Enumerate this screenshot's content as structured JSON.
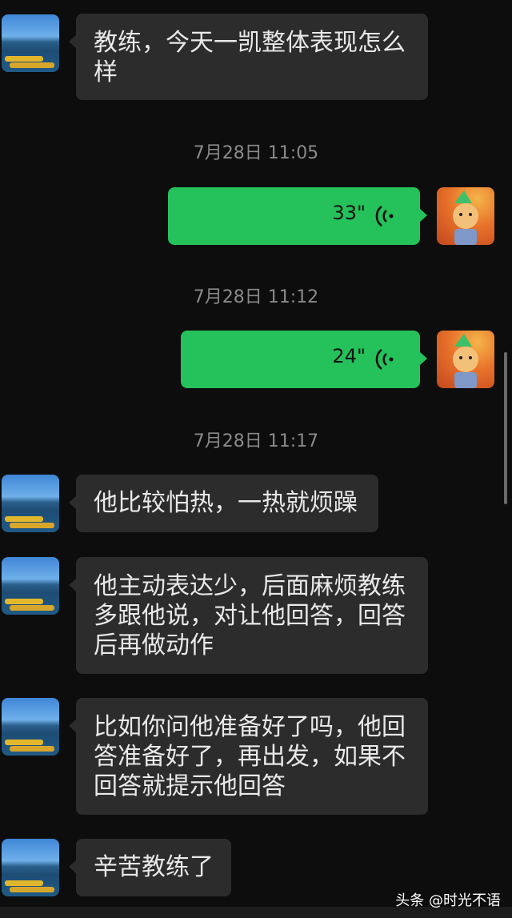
{
  "messages": [
    {
      "text": "教练，今天一凯整体表现怎么样"
    },
    {
      "text": "他比较怕热，一热就烦躁"
    },
    {
      "text": "他主动表达少，后面麻烦教练多跟他说，对让他回答，回答后再做动作"
    },
    {
      "text": "比如你问他准备好了吗，他回答准备好了，再出发，如果不回答就提示他回答"
    },
    {
      "text": "辛苦教练了"
    }
  ],
  "voice": [
    {
      "duration": "33\""
    },
    {
      "duration": "24\""
    }
  ],
  "timestamps": [
    "7月28日 11:05",
    "7月28日 11:12",
    "7月28日 11:17"
  ],
  "watermark": {
    "brand": "头条",
    "author": "@时光不语"
  },
  "colors": {
    "outgoing": "#25c15a",
    "incoming": "#2c2c2c",
    "background": "#0d0d0d"
  }
}
